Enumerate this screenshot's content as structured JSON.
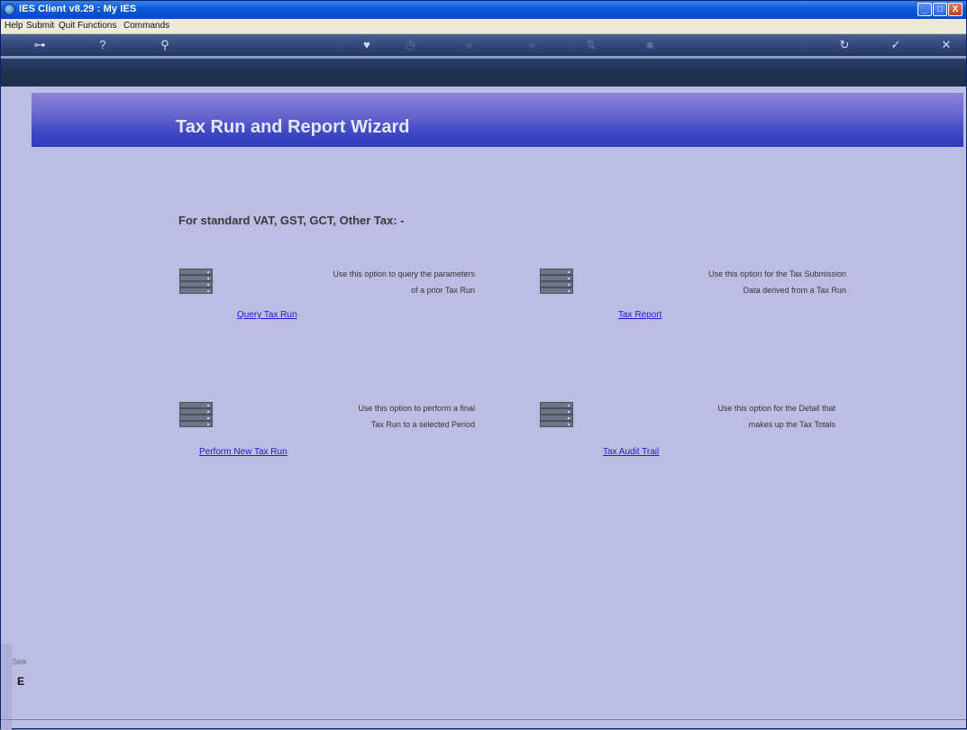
{
  "window": {
    "title": "IES Client v8.29 : My IES",
    "controls": {
      "minimize": "_",
      "maximize": "□",
      "close": "X"
    }
  },
  "menu": [
    "Help",
    "Submit",
    "Quit",
    "Functions",
    "Commands"
  ],
  "toolbar": {
    "buttons": [
      {
        "icon": "key-icon",
        "glyph": "⊶",
        "enabled": true
      },
      {
        "icon": "help-icon",
        "glyph": "?",
        "enabled": true
      },
      {
        "icon": "search-icon",
        "glyph": "⚲",
        "enabled": true
      },
      {
        "icon": "heart-icon",
        "glyph": "♥",
        "enabled": true
      },
      {
        "icon": "clock-icon",
        "glyph": "◷",
        "enabled": false
      },
      {
        "icon": "rewind-icon",
        "glyph": "«",
        "enabled": false
      },
      {
        "icon": "fast-forward-icon",
        "glyph": "»",
        "enabled": false
      },
      {
        "icon": "transfer-icon",
        "glyph": "⇅",
        "enabled": false
      },
      {
        "icon": "stop-icon",
        "glyph": "■",
        "enabled": false
      },
      {
        "icon": "refresh-icon",
        "glyph": "↻",
        "enabled": true
      },
      {
        "icon": "check-icon",
        "glyph": "✓",
        "enabled": true
      },
      {
        "icon": "close-icon",
        "glyph": "✕",
        "enabled": true
      }
    ]
  },
  "banner": {
    "title": "Tax Run and Report Wizard"
  },
  "section": {
    "title": "For standard VAT, GST, GCT, Other Tax: -"
  },
  "options": {
    "query": {
      "line1": "Use this option to query the parameters",
      "line2": "of a prior Tax Run",
      "link": "Query Tax Run"
    },
    "report": {
      "line1": "Use this option for the Tax Submission",
      "line2": "Data derived from a Tax Run",
      "link": "Tax Report"
    },
    "perform": {
      "line1": "Use this option to perform a final",
      "line2": "Tax Run to a selected Period",
      "link": "Perform New Tax Run"
    },
    "audit": {
      "line1": "Use this option for the Detail that",
      "line2": "makes up the Tax Totals",
      "link": "Tax Audit Trail"
    }
  },
  "sidebar": {
    "label": "Sea",
    "bullet": "E"
  },
  "colors": {
    "background": "#bdbde3",
    "banner": "#3d47c3",
    "link": "#1b1bd6",
    "toolbar": "#2d4277"
  }
}
